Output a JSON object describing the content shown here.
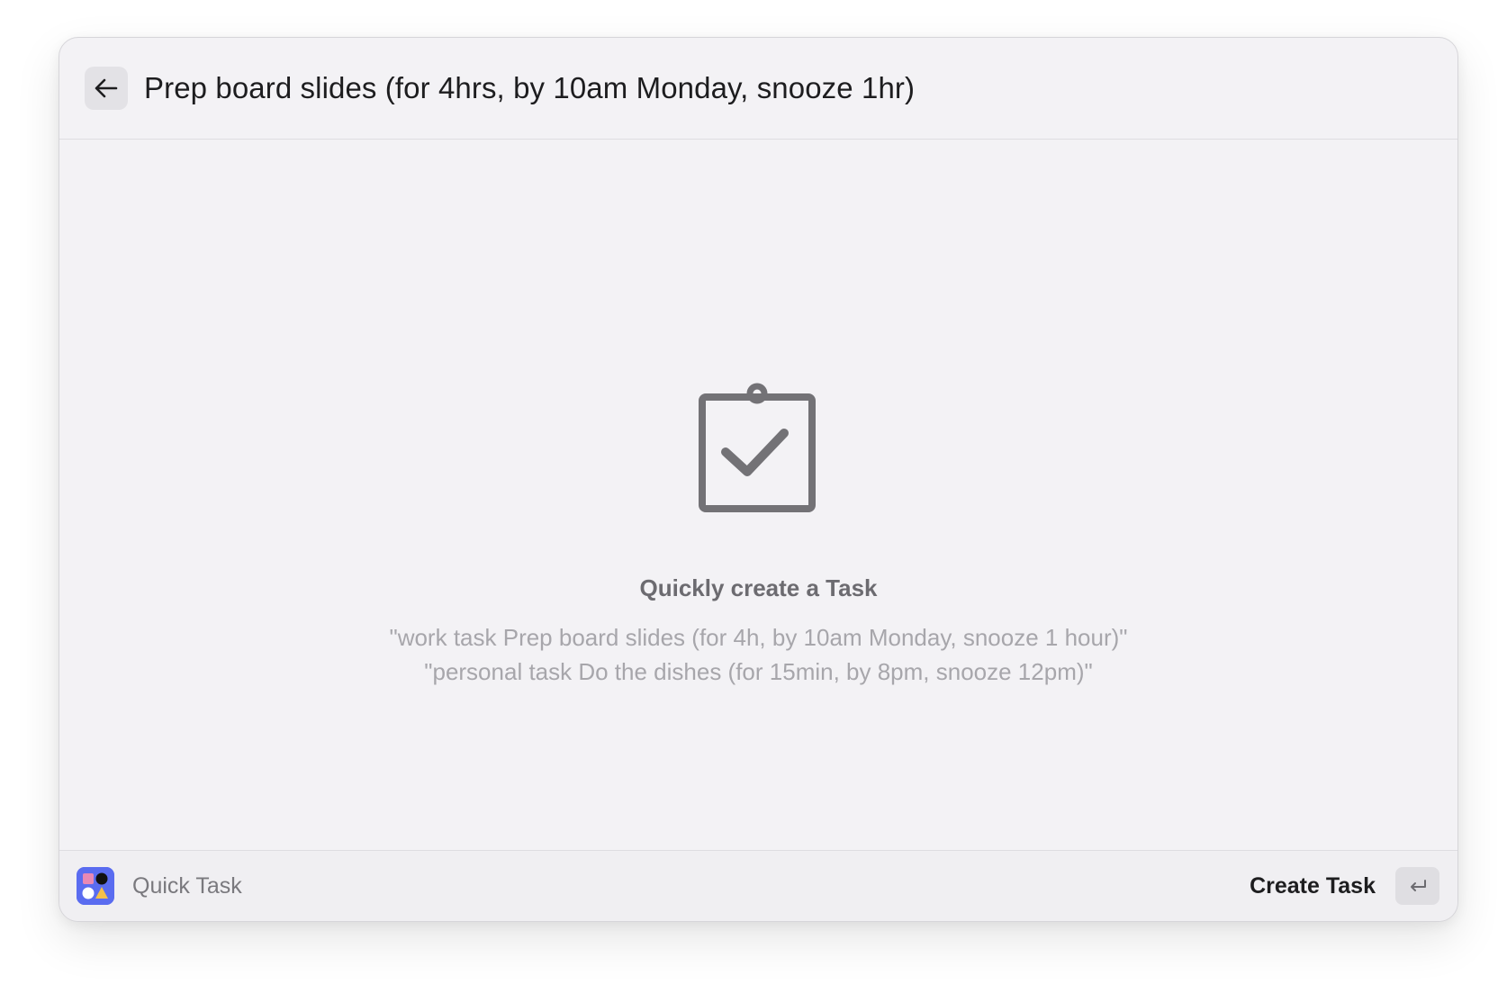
{
  "header": {
    "query": "Prep board slides (for 4hrs, by 10am Monday, snooze 1hr)"
  },
  "empty_state": {
    "icon": "clipboard-check-icon",
    "title": "Quickly create a Task",
    "examples": [
      "\"work task Prep board slides (for 4h, by 10am Monday, snooze 1 hour)\"",
      "\"personal task Do the dishes (for 15min, by 8pm, snooze 12pm)\""
    ]
  },
  "footer": {
    "app_name": "Quick Task",
    "action_label": "Create Task",
    "action_key_icon": "return-key-icon"
  },
  "colors": {
    "window_bg": "#f3f2f5",
    "app_icon_bg": "#5a6cf0",
    "icon_gray": "#737276"
  }
}
